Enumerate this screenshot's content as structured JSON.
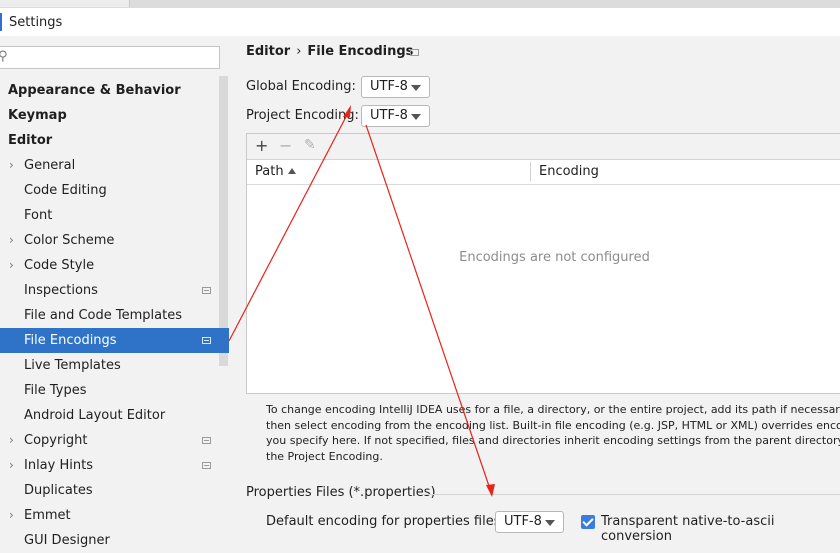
{
  "window": {
    "title": "Settings"
  },
  "sidebar": {
    "items": [
      {
        "label": "Appearance & Behavior",
        "type": "top"
      },
      {
        "label": "Keymap",
        "type": "top"
      },
      {
        "label": "Editor",
        "type": "top"
      },
      {
        "label": "General",
        "chevron": true
      },
      {
        "label": "Code Editing"
      },
      {
        "label": "Font"
      },
      {
        "label": "Color Scheme",
        "chevron": true
      },
      {
        "label": "Code Style",
        "chevron": true
      },
      {
        "label": "Inspections",
        "project_icon": true
      },
      {
        "label": "File and Code Templates"
      },
      {
        "label": "File Encodings",
        "project_icon": true,
        "selected": true
      },
      {
        "label": "Live Templates"
      },
      {
        "label": "File Types"
      },
      {
        "label": "Android Layout Editor"
      },
      {
        "label": "Copyright",
        "chevron": true,
        "project_icon": true
      },
      {
        "label": "Inlay Hints",
        "chevron": true,
        "project_icon": true
      },
      {
        "label": "Duplicates"
      },
      {
        "label": "Emmet",
        "chevron": true
      },
      {
        "label": "GUI Designer"
      }
    ]
  },
  "breadcrumb": {
    "parent": "Editor",
    "separator": "›",
    "current": "File Encodings"
  },
  "global_encoding": {
    "label": "Global Encoding:",
    "value": "UTF-8"
  },
  "project_encoding": {
    "label": "Project Encoding:",
    "value": "UTF-8"
  },
  "table": {
    "toolbar": {
      "add": "+",
      "remove": "−",
      "edit": "✎"
    },
    "columns": [
      "Path",
      "Encoding"
    ],
    "empty_text": "Encodings are not configured"
  },
  "help_lines": [
    "To change encoding IntelliJ IDEA uses for a file, a directory, or the entire project, add its path if necessary and",
    "then select encoding from the encoding list. Built-in file encoding (e.g. JSP, HTML or XML) overrides encoding",
    "you specify here. If not specified, files and directories inherit encoding settings from the parent directory or fr",
    "the Project Encoding."
  ],
  "properties": {
    "section_title": "Properties Files (*.properties)",
    "default_label": "Default encoding for properties files:",
    "default_value": "UTF-8",
    "native_to_ascii_label": "Transparent native-to-ascii conversion",
    "native_to_ascii_checked": true
  },
  "colors": {
    "selection": "#2e73c8",
    "accent": "#3b7ddd",
    "annotation_arrow": "#e8231a"
  }
}
